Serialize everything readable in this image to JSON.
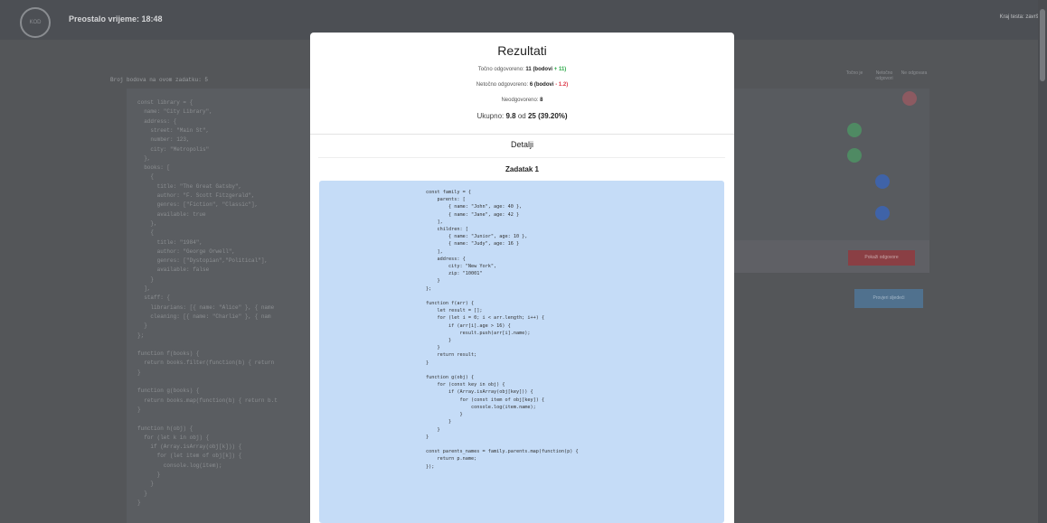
{
  "header": {
    "logo_text": "KOD",
    "timer": "Preostalo vrijeme: 18:48",
    "end_test": "Kraj testa: završi"
  },
  "background": {
    "points_label": "Broj bodova na ovom zadatku: 5",
    "code_lines": [
      "const library = {",
      "  name: \"City Library\",",
      "  address: {",
      "    street: \"Main St\",",
      "    number: 123,",
      "    city: \"Metropolis\"",
      "  },",
      "  books: [",
      "    {",
      "      title: \"The Great Gatsby\",",
      "      author: \"F. Scott Fitzgerald\",",
      "      genres: [\"Fiction\", \"Classic\"],",
      "      available: true",
      "    },",
      "    {",
      "      title: \"1984\",",
      "      author: \"George Orwell\",",
      "      genres: [\"Dystopian\",\"Political\"],",
      "      available: false",
      "    }",
      "  ],",
      "  staff: {",
      "    librarians: [{ name: \"Alice\" }, { name",
      "    cleaning: [{ name: \"Charlie\" }, { nam",
      "  }",
      "};",
      "",
      "function f(books) {",
      "  return books.filter(function(b) { return",
      "}",
      "",
      "function g(books) {",
      "  return books.map(function(b) { return b.t",
      "}",
      "",
      "function h(obj) {",
      "  for (let k in obj) {",
      "    if (Array.isArray(obj[k])) {",
      "      for (let item of obj[k]) {",
      "        console.log(item);",
      "      }",
      "    }",
      "  }",
      "}"
    ],
    "col_headers": [
      "Točno je",
      "Netočno odgovori",
      "Ne odgovara"
    ],
    "btn_show": "Pokaži odgovore",
    "btn_next": "Provjeri sljedeći"
  },
  "modal": {
    "title": "Rezultati",
    "correct_label": "Točno odgovoreno:",
    "correct_count": "11",
    "correct_points_label": "(bodovi",
    "correct_points": "+ 11)",
    "incorrect_label": "Netočno odgovoreno:",
    "incorrect_count": "6",
    "incorrect_points_label": "(bodovi",
    "incorrect_points": "- 1.2)",
    "unanswered_label": "Neodgovoreno:",
    "unanswered_count": "8",
    "total_label": "Ukupno:",
    "total_value": "9.8",
    "total_of": "od",
    "total_max": "25 (39.20%)",
    "details": "Detalji",
    "task_title": "Zadatak 1",
    "code": "const family = {\n    parents: [\n        { name: \"John\", age: 40 },\n        { name: \"Jane\", age: 42 }\n    ],\n    children: [\n        { name: \"Junior\", age: 10 },\n        { name: \"Judy\", age: 16 }\n    ],\n    address: {\n        city: \"New York\",\n        zip: \"10001\"\n    }\n};\n\nfunction f(arr) {\n    let result = [];\n    for (let i = 0; i < arr.length; i++) {\n        if (arr[i].age > 16) {\n            result.push(arr[i].name);\n        }\n    }\n    return result;\n}\n\nfunction g(obj) {\n    for (const key in obj) {\n        if (Array.isArray(obj[key])) {\n            for (const item of obj[key]) {\n                console.log(item.name);\n            }\n        }\n    }\n}\n\nconst parents_names = family.parents.map(function(p) {\n    return p.name;\n});"
  }
}
